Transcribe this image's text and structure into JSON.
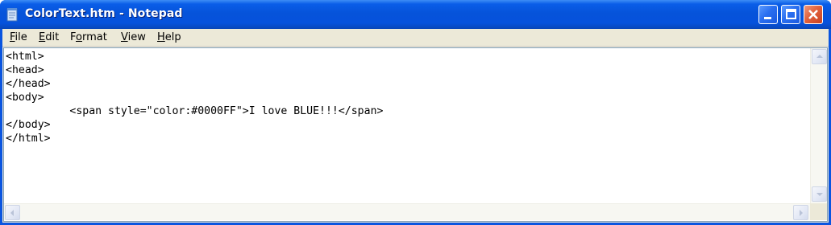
{
  "window": {
    "title": "ColorText.htm - Notepad",
    "app_icon": "notepad-icon",
    "controls": {
      "minimize_icon": "minimize-icon",
      "maximize_icon": "maximize-icon",
      "close_icon": "close-icon"
    },
    "colors": {
      "titlebar": "#0653da",
      "close_button": "#e2623d",
      "frame": "#ece9d8"
    }
  },
  "menu": {
    "items": [
      {
        "label": "File",
        "mnemonic": "F",
        "rest": "ile"
      },
      {
        "label": "Edit",
        "mnemonic": "E",
        "rest": "dit"
      },
      {
        "label": "Format",
        "mnemonic": "o",
        "prefix": "F",
        "rest": "rmat"
      },
      {
        "label": "View",
        "mnemonic": "V",
        "rest": "iew"
      },
      {
        "label": "Help",
        "mnemonic": "H",
        "rest": "elp"
      }
    ]
  },
  "editor": {
    "lines": [
      "<html>",
      "<head>",
      "</head>",
      "<body>",
      "\t<span style=\"color:#0000FF\">I love BLUE!!!</span>",
      "</body>",
      "</html>"
    ]
  }
}
